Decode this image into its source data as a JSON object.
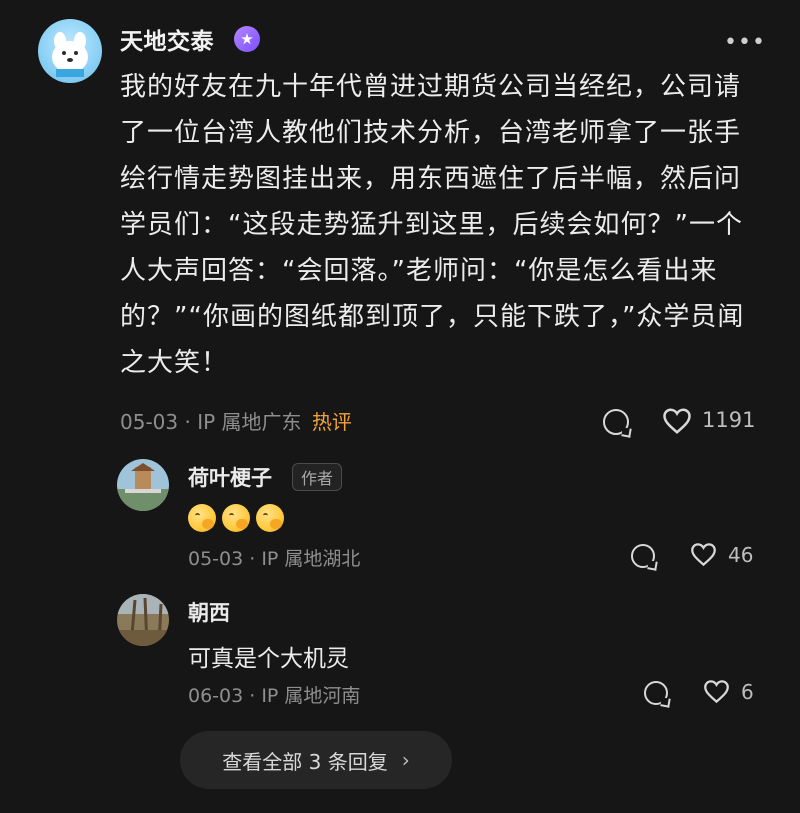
{
  "post": {
    "author": "天地交泰",
    "badge_icon": "star-badge-icon",
    "content": "我的好友在九十年代曾进过期货公司当经纪，公司请了一位台湾人教他们技术分析，台湾老师拿了一张手绘行情走势图挂出来，用东西遮住了后半幅，然后问学员们：“这段走势猛升到这里，后续会如何？”一个人大声回答：“会回落。”老师问：“你是怎么看出来的？”“你画的图纸都到顶了，只能下跌了，”众学员闻之大笑！",
    "meta": "05-03 · IP 属地广东",
    "hot_label": "热评",
    "like_count": "1191",
    "more_icon": "more-dots-icon"
  },
  "replies": [
    {
      "author": "荷叶梗子",
      "tag": "作者",
      "content_emojis": [
        "face-with-hand-over-mouth",
        "face-with-hand-over-mouth",
        "face-with-hand-over-mouth"
      ],
      "meta": "05-03 · IP 属地湖北",
      "like_count": "46"
    },
    {
      "author": "朝西",
      "content": "可真是个大机灵",
      "meta": "06-03 · IP 属地河南",
      "like_count": "6"
    }
  ],
  "view_all": {
    "label": "查看全部 3 条回复",
    "chevron": "›"
  },
  "colors": {
    "background": "#161616",
    "hot": "#f2a23a",
    "secondary_text": "#8e8e8e"
  }
}
